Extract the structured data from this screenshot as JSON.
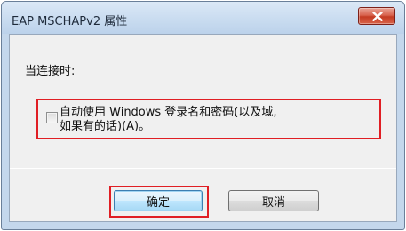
{
  "window": {
    "title": "EAP MSCHAPv2 属性"
  },
  "dialog": {
    "section_label": "当连接时:",
    "checkbox": {
      "label_line1": "自动使用 Windows 登录名和密码(以及域,",
      "label_line2": "如果有的话)(A)。",
      "checked": false
    }
  },
  "buttons": {
    "ok_label": "确定",
    "cancel_label": "取消"
  },
  "colors": {
    "highlight": "#e01e24",
    "close_button": "#c43b22",
    "title_bar": "#c9dcf0"
  }
}
